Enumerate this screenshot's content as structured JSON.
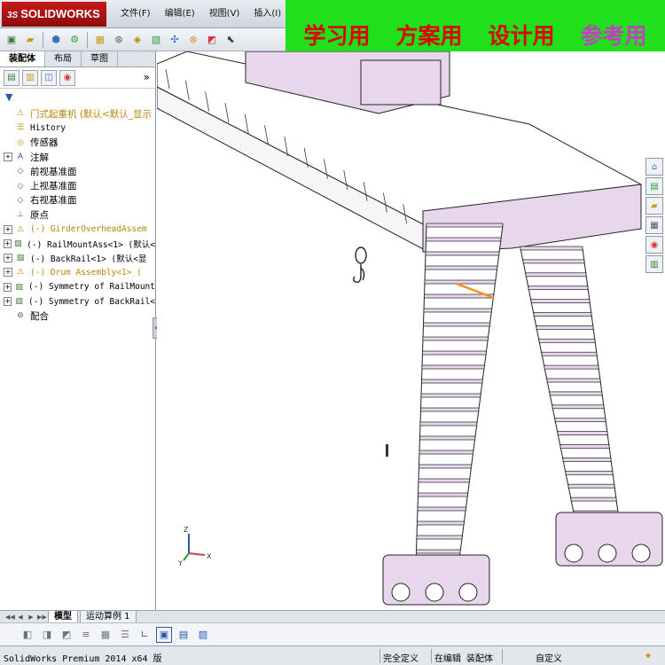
{
  "app": {
    "logo_text": "SOLIDWORKS",
    "logo_prefix": "3S"
  },
  "menu": [
    "文件(F)",
    "编辑(E)",
    "视图(V)",
    "插入(I)"
  ],
  "promo": {
    "items": [
      {
        "text": "学习用",
        "color": "#e00000"
      },
      {
        "text": "方案用",
        "color": "#e00000"
      },
      {
        "text": "设计用",
        "color": "#e00000"
      },
      {
        "text": "参考用",
        "color": "#c040c0"
      }
    ],
    "background": "#1fe01a"
  },
  "panel_tabs": [
    "装配体",
    "布局",
    "草图"
  ],
  "feature_tree": {
    "root": "门式起重机 (默认<默认_显示",
    "items": [
      {
        "label": "History",
        "icon": "history-icon",
        "expandable": false,
        "mono": true
      },
      {
        "label": "传感器",
        "icon": "sensor-icon",
        "expandable": false,
        "mono": false
      },
      {
        "label": "注解",
        "icon": "annotation-icon",
        "expandable": true,
        "mono": false
      },
      {
        "label": "前视基准面",
        "icon": "plane-icon",
        "expandable": false,
        "mono": false
      },
      {
        "label": "上视基准面",
        "icon": "plane-icon",
        "expandable": false,
        "mono": false
      },
      {
        "label": "右视基准面",
        "icon": "plane-icon",
        "expandable": false,
        "mono": false
      },
      {
        "label": "原点",
        "icon": "origin-icon",
        "expandable": false,
        "mono": false
      },
      {
        "label": "(-) GirderOverheadAssem",
        "icon": "warning-assembly-icon",
        "expandable": true,
        "mono": true,
        "warn": true
      },
      {
        "label": "(-) RailMountAss<1> (默认<",
        "icon": "assembly-icon",
        "expandable": true,
        "mono": true
      },
      {
        "label": "(-) BackRail<1> (默认<显",
        "icon": "assembly-icon",
        "expandable": true,
        "mono": true
      },
      {
        "label": "(-) Drum Assembly<1> (",
        "icon": "warning-assembly-icon",
        "expandable": true,
        "mono": true,
        "warn": true
      },
      {
        "label": "(-) Symmetry of RailMount",
        "icon": "assembly-icon",
        "expandable": true,
        "mono": true
      },
      {
        "label": "(-) Symmetry of BackRail<",
        "icon": "assembly-icon",
        "expandable": true,
        "mono": true
      },
      {
        "label": "配合",
        "icon": "mates-icon",
        "expandable": false,
        "mono": false
      }
    ]
  },
  "bottom_tabs": [
    "模型",
    "运动算例 1"
  ],
  "status": {
    "product": "SolidWorks Premium 2014 x64 版",
    "state1": "完全定义",
    "state2": "在编辑 装配体",
    "custom": "自定义"
  },
  "colors": {
    "model_fill": "#e8d6ec",
    "model_stroke": "#222222",
    "accent_orange": "#ff8c1a"
  }
}
